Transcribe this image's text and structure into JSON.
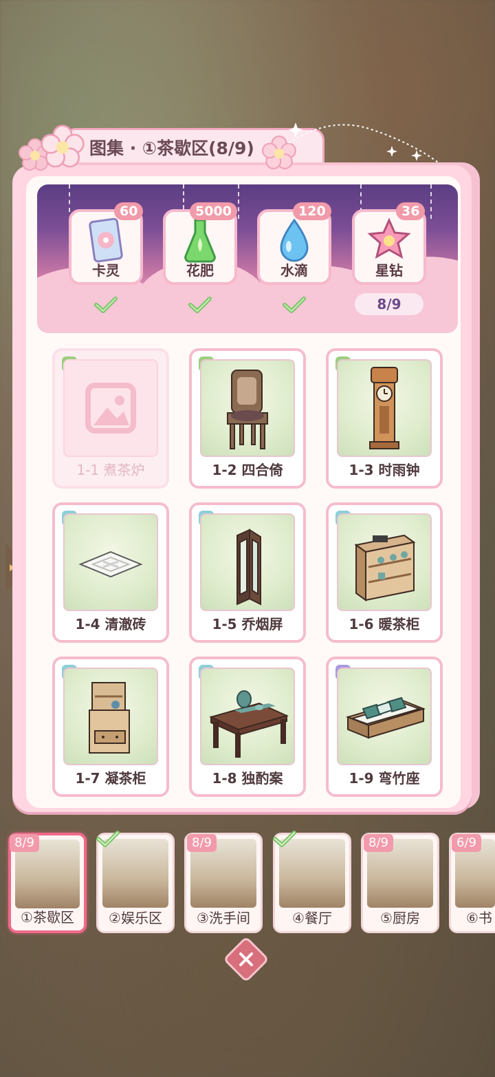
{
  "title": "图集 · ①茶歇区(8/9)",
  "rewards": [
    {
      "label": "卡灵",
      "qty": "60",
      "icon": "card-icon",
      "claimed": true
    },
    {
      "label": "花肥",
      "qty": "5000",
      "icon": "fertilizer-flask-icon",
      "claimed": true
    },
    {
      "label": "水滴",
      "qty": "120",
      "icon": "water-drop-icon",
      "claimed": true
    },
    {
      "label": "星钻",
      "qty": "36",
      "icon": "star-diamond-icon",
      "claimed": false,
      "progress": "8/9"
    }
  ],
  "items": [
    {
      "name": "1-1 煮茶炉",
      "rarity": "B",
      "locked": true,
      "icon": "image-placeholder-icon"
    },
    {
      "name": "1-2 四合倚",
      "rarity": "B",
      "locked": false,
      "icon": "chair-icon"
    },
    {
      "name": "1-3 时雨钟",
      "rarity": "B",
      "locked": false,
      "icon": "grandfather-clock-icon"
    },
    {
      "name": "1-4 清澈砖",
      "rarity": "A",
      "locked": false,
      "icon": "floor-tile-icon"
    },
    {
      "name": "1-5 乔烟屏",
      "rarity": "A",
      "locked": false,
      "icon": "folding-screen-icon"
    },
    {
      "name": "1-6 暖茶柜",
      "rarity": "A",
      "locked": false,
      "icon": "tea-cabinet-icon"
    },
    {
      "name": "1-7 凝茶柜",
      "rarity": "A",
      "locked": false,
      "icon": "small-cabinet-icon"
    },
    {
      "name": "1-8 独酌案",
      "rarity": "A",
      "locked": false,
      "icon": "tea-table-icon"
    },
    {
      "name": "1-9 弯竹座",
      "rarity": "S",
      "locked": false,
      "icon": "sofa-icon"
    }
  ],
  "zones": [
    {
      "label": "①茶歇区",
      "badge": "8/9",
      "complete": false,
      "active": true
    },
    {
      "label": "②娱乐区",
      "badge": "",
      "complete": true,
      "active": false
    },
    {
      "label": "③洗手间",
      "badge": "8/9",
      "complete": false,
      "active": false
    },
    {
      "label": "④餐厅",
      "badge": "",
      "complete": true,
      "active": false
    },
    {
      "label": "⑤厨房",
      "badge": "8/9",
      "complete": false,
      "active": false
    },
    {
      "label": "⑥书",
      "badge": "6/9",
      "complete": false,
      "active": false
    }
  ],
  "colors": {
    "accent": "#ef6a8a",
    "panel": "#ffd6e2",
    "rarity_A": "#8ccfd9",
    "rarity_B": "#9ccf7f",
    "rarity_S": "#a79ae0"
  }
}
